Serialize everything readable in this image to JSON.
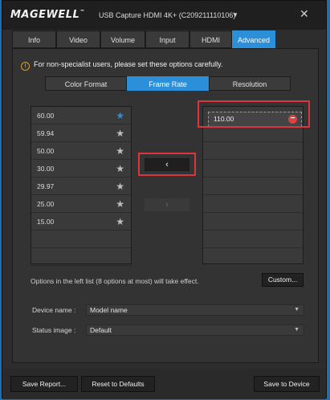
{
  "window": {
    "logo": "MAGEWELL",
    "logo_mark": "™",
    "device_title": "USB Capture HDMI 4K+ (C209211110106)",
    "close_label": "✕"
  },
  "tabs": [
    {
      "label": "Info"
    },
    {
      "label": "Video"
    },
    {
      "label": "Volume"
    },
    {
      "label": "Input"
    },
    {
      "label": "HDMI"
    },
    {
      "label": "Advanced",
      "active": true
    }
  ],
  "warning": "For non-specialist users, please set these options carefully.",
  "subtabs": [
    {
      "label": "Color Format"
    },
    {
      "label": "Frame Rate",
      "active": true
    },
    {
      "label": "Resolution"
    }
  ],
  "available_rates": [
    "60.00",
    "59.94",
    "50.00",
    "30.00",
    "29.97",
    "25.00",
    "15.00"
  ],
  "selected_rates": [
    "110.00"
  ],
  "move_left_label": "‹",
  "move_right_label": "›",
  "hint": "Options in the left list (8 options at most) will take effect.",
  "custom_button": "Custom...",
  "device_name": {
    "label": "Device name :",
    "value": "Model name"
  },
  "status_image": {
    "label": "Status image :",
    "value": "Default"
  },
  "footer": {
    "save_report": "Save Report...",
    "reset": "Reset to Defaults",
    "save_device": "Save to Device"
  },
  "colors": {
    "accent": "#2b8fd9",
    "highlight": "#d9363e",
    "warning": "#e59a1a"
  }
}
